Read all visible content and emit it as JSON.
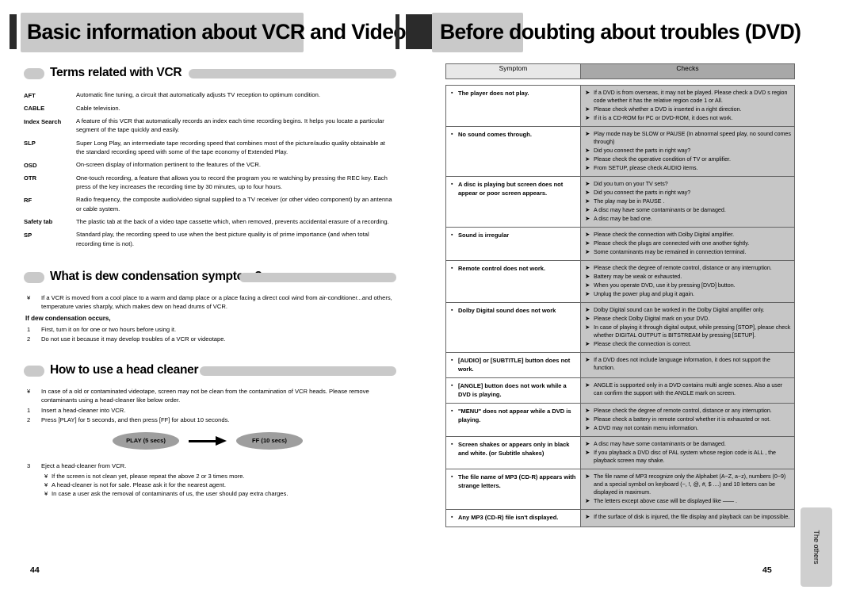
{
  "left_page": {
    "banner_title": "Basic information about VCR and Videotape",
    "page_number": "44",
    "sections": [
      {
        "title": "Terms related with VCR"
      },
      {
        "title": "What is dew condensation symptom?"
      },
      {
        "title": "How to use a head cleaner"
      }
    ],
    "glossary": [
      {
        "term": "AFT",
        "desc": "Automatic fine tuning, a circuit that automatically adjusts TV reception to optimum condition."
      },
      {
        "term": "CABLE",
        "desc": "Cable television."
      },
      {
        "term": "Index Search",
        "desc": "A feature of this VCR that automatically records an index each time recording begins. It helps you locate a particular segment of the tape quickly and easily."
      },
      {
        "term": "SLP",
        "desc": "Super Long Play, an intermediate tape recording speed that combines most of the picture/audio quality obtainable at the standard recording speed with some of the tape economy of Extended Play."
      },
      {
        "term": "OSD",
        "desc": "On-screen display of information pertinent to the features of the VCR."
      },
      {
        "term": "OTR",
        "desc": "One-touch recording, a feature that allows you to record the program you re watching by pressing the REC key. Each press of the key increases the recording time by 30 minutes, up to four hours."
      },
      {
        "term": "RF",
        "desc": "Radio frequency, the composite audio/video signal supplied to a TV receiver (or other video component) by an antenna or cable system."
      },
      {
        "term": "Safety tab",
        "desc": "The plastic tab at the back of a video tape cassette which, when removed, prevents accidental erasure of a recording."
      },
      {
        "term": "SP",
        "desc": "Standard play, the recording speed to use when the best picture quality is of prime importance (and when total recording time is not)."
      }
    ],
    "dew": {
      "bullet_mark": "¥",
      "bullet": "If a VCR is moved from a cool place to a warm and damp place or a place facing a direct cool wind from air-conditioner...and others, temperature varies sharply, which makes dew on head drums of VCR.",
      "subhead": "If dew condensation occurs,",
      "steps": [
        {
          "n": "1",
          "t": "First, turn it on for one or two hours before using it."
        },
        {
          "n": "2",
          "t": "Do not use it because it may develop troubles of a VCR or videotape."
        }
      ]
    },
    "head_cleaner": {
      "bullet_mark": "¥",
      "bullet": "In case of a old or contaminated videotape, screen may not be clean from the contamination of VCR heads. Please remove contaminants using a head-cleaner like below order.",
      "steps": [
        {
          "n": "1",
          "t": "Insert a head-cleaner into VCR."
        },
        {
          "n": "2",
          "t": "Press [PLAY] for 5 seconds, and then press [FF] for about 10 seconds."
        }
      ],
      "flow": {
        "left_label": "PLAY (5 secs)",
        "right_label": "FF (10 secs)"
      },
      "step3": {
        "n": "3",
        "t": "Eject a head-cleaner from VCR."
      },
      "notes": [
        "If the screen is not clean yet, please repeat the above 2 or 3 times more.",
        "A head-cleaner is not for sale. Please ask it for the nearest agent.",
        "In case a user ask the removal of contaminants of us, the user should pay extra charges."
      ]
    }
  },
  "right_page": {
    "banner_title": "Before doubting about troubles (DVD)",
    "page_number": "45",
    "thumb_tab": "The others",
    "table": {
      "headers": {
        "symptom": "Symptom",
        "checks": "Checks"
      },
      "symptom_bullet": "▪",
      "check_bullet": "➤",
      "rows": [
        {
          "symptom": "The player does not play.",
          "checks": [
            "If a DVD is from overseas, it may not be played. Please check a DVD s region code whether it has the relative region code 1 or All.",
            "Please check whether a DVD is inserted in a right direction.",
            "If it is a CD-ROM for PC or DVD-ROM, it does not work."
          ]
        },
        {
          "symptom": "No sound comes through.",
          "checks": [
            "Play mode may be  SLOW  or  PAUSE (In abnormal speed play, no sound comes through)",
            "Did you connect the parts in right way?",
            "Please check the operative condition of TV or amplifier.",
            "From  SETUP, please check  AUDIO  items."
          ]
        },
        {
          "symptom": "A disc is playing but screen does not appear or poor screen appears.",
          "checks": [
            "Did you turn on your TV sets?",
            "Did you connect the parts in right way?",
            "The play may be in  PAUSE .",
            "A disc may have some contaminants or be damaged.",
            "A disc may be bad one."
          ]
        },
        {
          "symptom": "Sound is irregular",
          "checks": [
            "Please check the connection with Dolby Digital amplifier.",
            "Please check the plugs are connected with one another tightly.",
            "Some contaminants may be remained in connection terminal."
          ]
        },
        {
          "symptom": "Remote control does not work.",
          "checks": [
            "Please check the degree of remote control, distance or any interruption.",
            "Battery may be weak or exhausted.",
            "When you operate DVD, use it by pressing [DVD] button.",
            "Unplug the power plug and plug it again."
          ]
        },
        {
          "symptom": "Dolby Digital  sound does not work",
          "checks": [
            "Dolby Digital  sound can be worked in the Dolby Digital amplifier only.",
            "Please check  Dolby Digital   mark on your DVD.",
            "In case of playing it through digital output, while pressing [STOP], please check whether  DIGITAL OUTPUT  is  BITSTREAM  by pressing [SETUP].",
            "Please check the connection is correct."
          ]
        },
        {
          "symptom": "[AUDIO] or  [SUBTITLE] button does not work.",
          "checks": [
            "If a DVD does not include language information, it does not support the function."
          ]
        },
        {
          "symptom": "[ANGLE] button does not work while a DVD is playing.",
          "checks": [
            " ANGLE  is supported only in a DVD contains multi angle scenes. Also a user can confirm the support with the  ANGLE  mark on screen."
          ]
        },
        {
          "symptom": "\"MENU\" does not appear while a DVD is playing.",
          "checks": [
            "Please check the degree of remote control, distance or any interruption.",
            "Please check a battery in remote control whether it is exhausted or not.",
            "A DVD may not contain menu information."
          ]
        },
        {
          "symptom": "Screen shakes or appears only in black and white. (or Subtitle shakes)",
          "checks": [
            "A disc may have some contaminants or be damaged.",
            "If you playback a DVD disc of PAL system whose region code is  ALL , the playback screen may shake."
          ]
        },
        {
          "symptom": "The file name of MP3 (CD-R) appears with strange letters.",
          "checks": [
            "The file name of MP3 recognize only the Alphabet (A~Z, a~z), numbers (0~9) and a special symbol on keyboard (~, !, @, #, $ ....) and 10 letters can be displayed in maximum.",
            "The letters except above case will be displayed like  —— ."
          ]
        },
        {
          "symptom": "Any MP3 (CD-R) file isn't displayed.",
          "checks": [
            "If the surface of disk is injured, the file display and playback can be impossible."
          ]
        }
      ]
    }
  }
}
